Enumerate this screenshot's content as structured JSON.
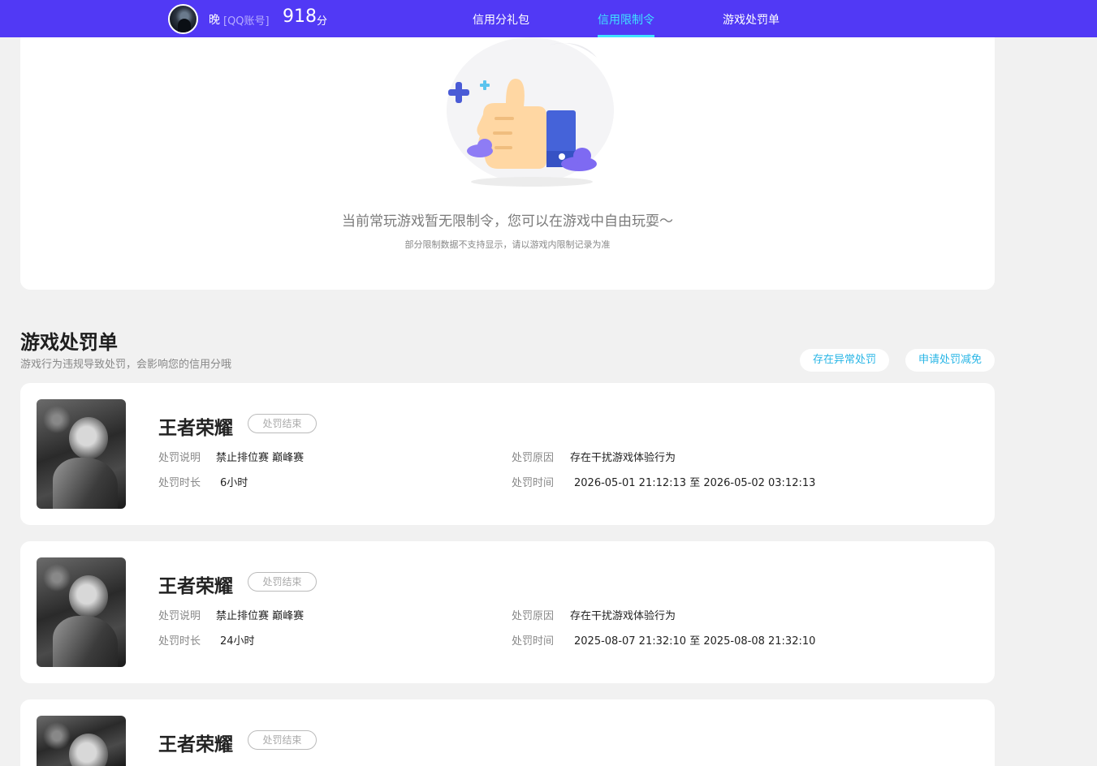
{
  "header": {
    "nickname": "晚",
    "account_type": "[QQ账号]",
    "score": "918",
    "score_unit": "分",
    "nav": [
      {
        "label": "信用分礼包",
        "active": false
      },
      {
        "label": "信用限制令",
        "active": true
      },
      {
        "label": "游戏处罚单",
        "active": false
      }
    ]
  },
  "colors": {
    "brand": "#5139f5",
    "active_nav": "#3fe2ff",
    "pill_text": "#29b6e6"
  },
  "limits": {
    "empty_message": "当前常玩游戏暂无限制令，您可以在游戏中自由玩耍～",
    "note": "部分限制数据不支持显示，请以游戏内限制记录为准"
  },
  "penalties": {
    "title": "游戏处罚单",
    "subtitle": "游戏行为违规导致处罚，会影响您的信用分哦",
    "actions": [
      "存在异常处罚",
      "申请处罚减免"
    ],
    "labels": {
      "desc": "处罚说明",
      "reason": "处罚原因",
      "duration": "处罚时长",
      "time": "处罚时间"
    },
    "items": [
      {
        "game": "王者荣耀",
        "status": "处罚结束",
        "desc": "禁止排位赛 巅峰赛",
        "reason": "存在干扰游戏体验行为",
        "duration": "6小时",
        "time": "2026-05-01 21:12:13 至 2026-05-02 03:12:13"
      },
      {
        "game": "王者荣耀",
        "status": "处罚结束",
        "desc": "禁止排位赛 巅峰赛",
        "reason": "存在干扰游戏体验行为",
        "duration": "24小时",
        "time": "2025-08-07 21:32:10 至 2025-08-08 21:32:10"
      },
      {
        "game": "王者荣耀",
        "status": "处罚结束"
      }
    ]
  }
}
